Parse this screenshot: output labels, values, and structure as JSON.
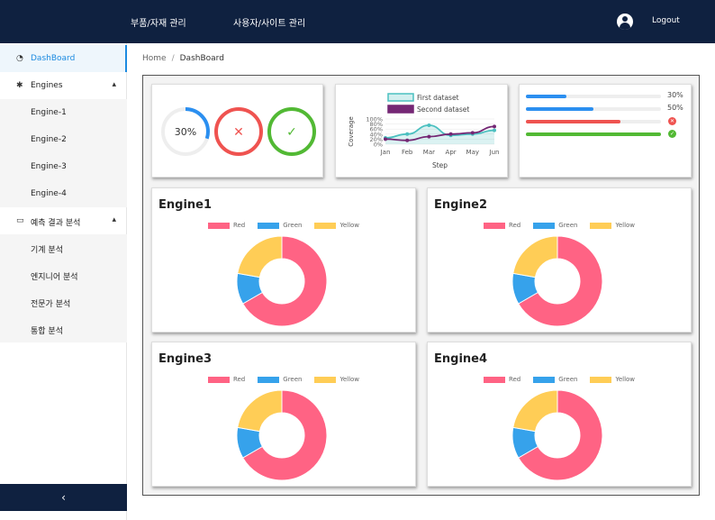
{
  "topbar": {
    "nav": [
      "부품/자재 관리",
      "사용자/사이트 관리"
    ],
    "user_icon": "user-circle-icon",
    "logout_label": "Logout"
  },
  "sidebar": {
    "items": [
      {
        "label": "DashBoard",
        "icon": "gauge-icon",
        "active": true
      },
      {
        "label": "Engines",
        "icon": "gear-icon",
        "expanded": true,
        "chevron": "▴"
      },
      {
        "label": "Engine-1"
      },
      {
        "label": "Engine-2"
      },
      {
        "label": "Engine-3"
      },
      {
        "label": "Engine-4"
      },
      {
        "label": "예측 결과 분석",
        "icon": "laptop-icon",
        "expanded": true,
        "chevron": "▴"
      },
      {
        "label": "기계 분석"
      },
      {
        "label": "엔지니어 분석"
      },
      {
        "label": "전문가 분석"
      },
      {
        "label": "통합 분석"
      }
    ],
    "collapse_glyph": "‹"
  },
  "breadcrumb": {
    "home": "Home",
    "separator": "/",
    "current": "DashBoard"
  },
  "gauges": {
    "percent_label": "30%",
    "percent_value": 30,
    "error_glyph": "✕",
    "success_glyph": "✓",
    "colors": {
      "blue": "#2b8ff0",
      "red": "#ef5350",
      "green": "#52b934",
      "track": "#eeeeee"
    }
  },
  "line_chart": {
    "chart_data": {
      "type": "line",
      "x": [
        "Jan",
        "Feb",
        "Mar",
        "Apr",
        "May",
        "Jun"
      ],
      "series": [
        {
          "name": "First dataset",
          "values": [
            25,
            40,
            75,
            35,
            40,
            55
          ],
          "color": "#4bc0c0",
          "fill": true
        },
        {
          "name": "Second dataset",
          "values": [
            20,
            15,
            30,
            40,
            45,
            70
          ],
          "color": "#742774",
          "fill": false
        }
      ],
      "xlabel": "Step",
      "ylabel": "Coverage",
      "yticks": [
        "100%",
        "80%",
        "60%",
        "40%",
        "20%",
        "0%"
      ],
      "ylim": [
        0,
        100
      ],
      "legend": "top"
    }
  },
  "progress": [
    {
      "value": 30,
      "label": "30%",
      "color": "#2b8ff0",
      "kind": "text"
    },
    {
      "value": 50,
      "label": "50%",
      "color": "#2b8ff0",
      "kind": "text"
    },
    {
      "value": 70,
      "label": "✕",
      "color": "#ef5350",
      "kind": "error-icon"
    },
    {
      "value": 100,
      "label": "✓",
      "color": "#52b934",
      "kind": "success-icon"
    }
  ],
  "engines": [
    {
      "title": "Engine1"
    },
    {
      "title": "Engine2"
    },
    {
      "title": "Engine3"
    },
    {
      "title": "Engine4"
    }
  ],
  "donut_legend": [
    {
      "label": "Red",
      "color": "#ff6384"
    },
    {
      "label": "Green",
      "color": "#36a2eb"
    },
    {
      "label": "Yellow",
      "color": "#ffcd56"
    }
  ],
  "donut_chart_data": {
    "type": "pie",
    "categories": [
      "Red",
      "Green",
      "Yellow"
    ],
    "values": [
      300,
      50,
      100
    ]
  }
}
